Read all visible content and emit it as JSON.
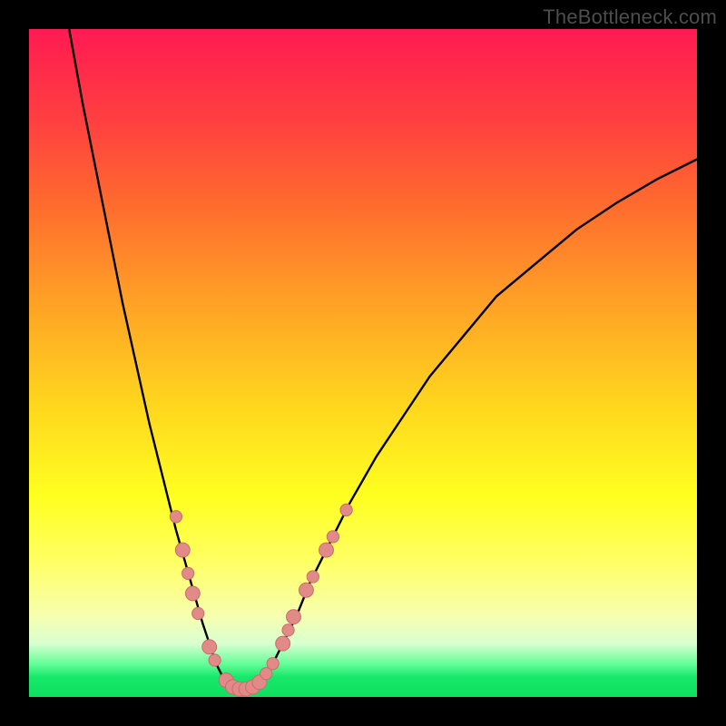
{
  "watermark": "TheBottleneck.com",
  "colors": {
    "frame": "#000000",
    "curve": "#000000",
    "dot_fill": "#e28a88",
    "dot_stroke": "#c86d6b",
    "gradient_top": "#ff1a53",
    "gradient_bottom": "#0fe060"
  },
  "chart_data": {
    "type": "line",
    "title": "",
    "xlabel": "",
    "ylabel": "",
    "xlim": [
      0,
      100
    ],
    "ylim": [
      0,
      100
    ],
    "grid": false,
    "legend": false,
    "series": [
      {
        "name": "curve-left",
        "x": [
          6,
          8,
          10,
          12,
          14,
          16,
          18,
          20,
          22,
          24,
          26,
          27,
          28,
          29,
          30
        ],
        "values": [
          100,
          89,
          79,
          69,
          59,
          50,
          41,
          33,
          25,
          18,
          11,
          8,
          5,
          3,
          1.5
        ]
      },
      {
        "name": "curve-floor",
        "x": [
          30,
          31,
          32,
          33,
          34
        ],
        "values": [
          1.5,
          1.0,
          1.0,
          1.0,
          1.5
        ]
      },
      {
        "name": "curve-right",
        "x": [
          34,
          36,
          38,
          40,
          42,
          45,
          48,
          52,
          56,
          60,
          65,
          70,
          76,
          82,
          88,
          94,
          100
        ],
        "values": [
          1.5,
          4,
          8,
          12,
          17,
          23,
          29,
          36,
          42,
          48,
          54,
          60,
          65,
          70,
          74,
          77.5,
          80.5
        ]
      }
    ],
    "dots": [
      {
        "x": 22.0,
        "y": 27.0,
        "r": 1.0
      },
      {
        "x": 23.0,
        "y": 22.0,
        "r": 1.2
      },
      {
        "x": 23.8,
        "y": 18.5,
        "r": 1.0
      },
      {
        "x": 24.5,
        "y": 15.5,
        "r": 1.2
      },
      {
        "x": 25.3,
        "y": 12.5,
        "r": 1.0
      },
      {
        "x": 27.0,
        "y": 7.5,
        "r": 1.2
      },
      {
        "x": 27.8,
        "y": 5.5,
        "r": 1.0
      },
      {
        "x": 29.5,
        "y": 2.5,
        "r": 1.2
      },
      {
        "x": 30.5,
        "y": 1.5,
        "r": 1.2
      },
      {
        "x": 31.5,
        "y": 1.2,
        "r": 1.2
      },
      {
        "x": 32.5,
        "y": 1.2,
        "r": 1.2
      },
      {
        "x": 33.5,
        "y": 1.5,
        "r": 1.2
      },
      {
        "x": 34.5,
        "y": 2.2,
        "r": 1.2
      },
      {
        "x": 35.5,
        "y": 3.5,
        "r": 1.0
      },
      {
        "x": 36.5,
        "y": 5.0,
        "r": 1.0
      },
      {
        "x": 38.0,
        "y": 8.0,
        "r": 1.2
      },
      {
        "x": 38.8,
        "y": 10.0,
        "r": 1.0
      },
      {
        "x": 39.6,
        "y": 12.0,
        "r": 1.2
      },
      {
        "x": 41.5,
        "y": 16.0,
        "r": 1.2
      },
      {
        "x": 42.5,
        "y": 18.0,
        "r": 1.0
      },
      {
        "x": 44.5,
        "y": 22.0,
        "r": 1.2
      },
      {
        "x": 45.5,
        "y": 24.0,
        "r": 1.0
      },
      {
        "x": 47.5,
        "y": 28.0,
        "r": 1.0
      }
    ]
  }
}
